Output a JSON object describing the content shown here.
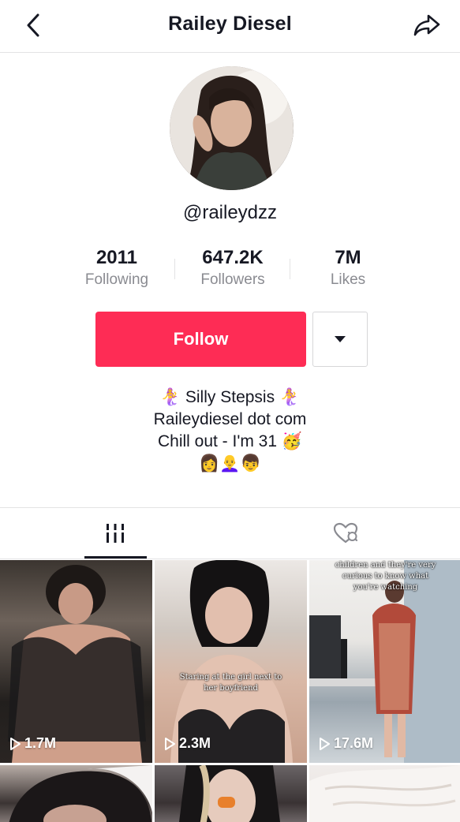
{
  "header": {
    "title": "Railey Diesel",
    "back_icon": "chevron-left-icon",
    "share_icon": "share-arrow-icon"
  },
  "profile": {
    "handle": "@raileydzz",
    "stats": [
      {
        "value": "2011",
        "label": "Following"
      },
      {
        "value": "647.2K",
        "label": "Followers"
      },
      {
        "value": "7M",
        "label": "Likes"
      }
    ],
    "follow_label": "Follow",
    "more_icon": "caret-down-icon",
    "bio_lines": [
      "🧜‍♀️ Silly Stepsis 🧜‍♀️",
      "Raileydiesel dot com",
      "Chill out - I'm 31 🥳",
      "👩👩‍🦲👦"
    ]
  },
  "tabs": [
    {
      "name": "videos",
      "icon": "grid-columns-icon",
      "active": true
    },
    {
      "name": "liked",
      "icon": "heart-hidden-icon",
      "active": false
    }
  ],
  "videos": [
    {
      "views": "1.7M",
      "caption": ""
    },
    {
      "views": "2.3M",
      "caption": "Staring at the girl next to her boyfriend"
    },
    {
      "views": "17.6M",
      "caption": "children and they're very curious to know what you're watching"
    },
    {
      "views": "",
      "caption": ""
    },
    {
      "views": "",
      "caption": ""
    },
    {
      "views": "",
      "caption": ""
    }
  ],
  "colors": {
    "accent": "#fe2c55",
    "text": "#161823",
    "muted": "#8a8b91",
    "divider": "#e3e3e4"
  }
}
